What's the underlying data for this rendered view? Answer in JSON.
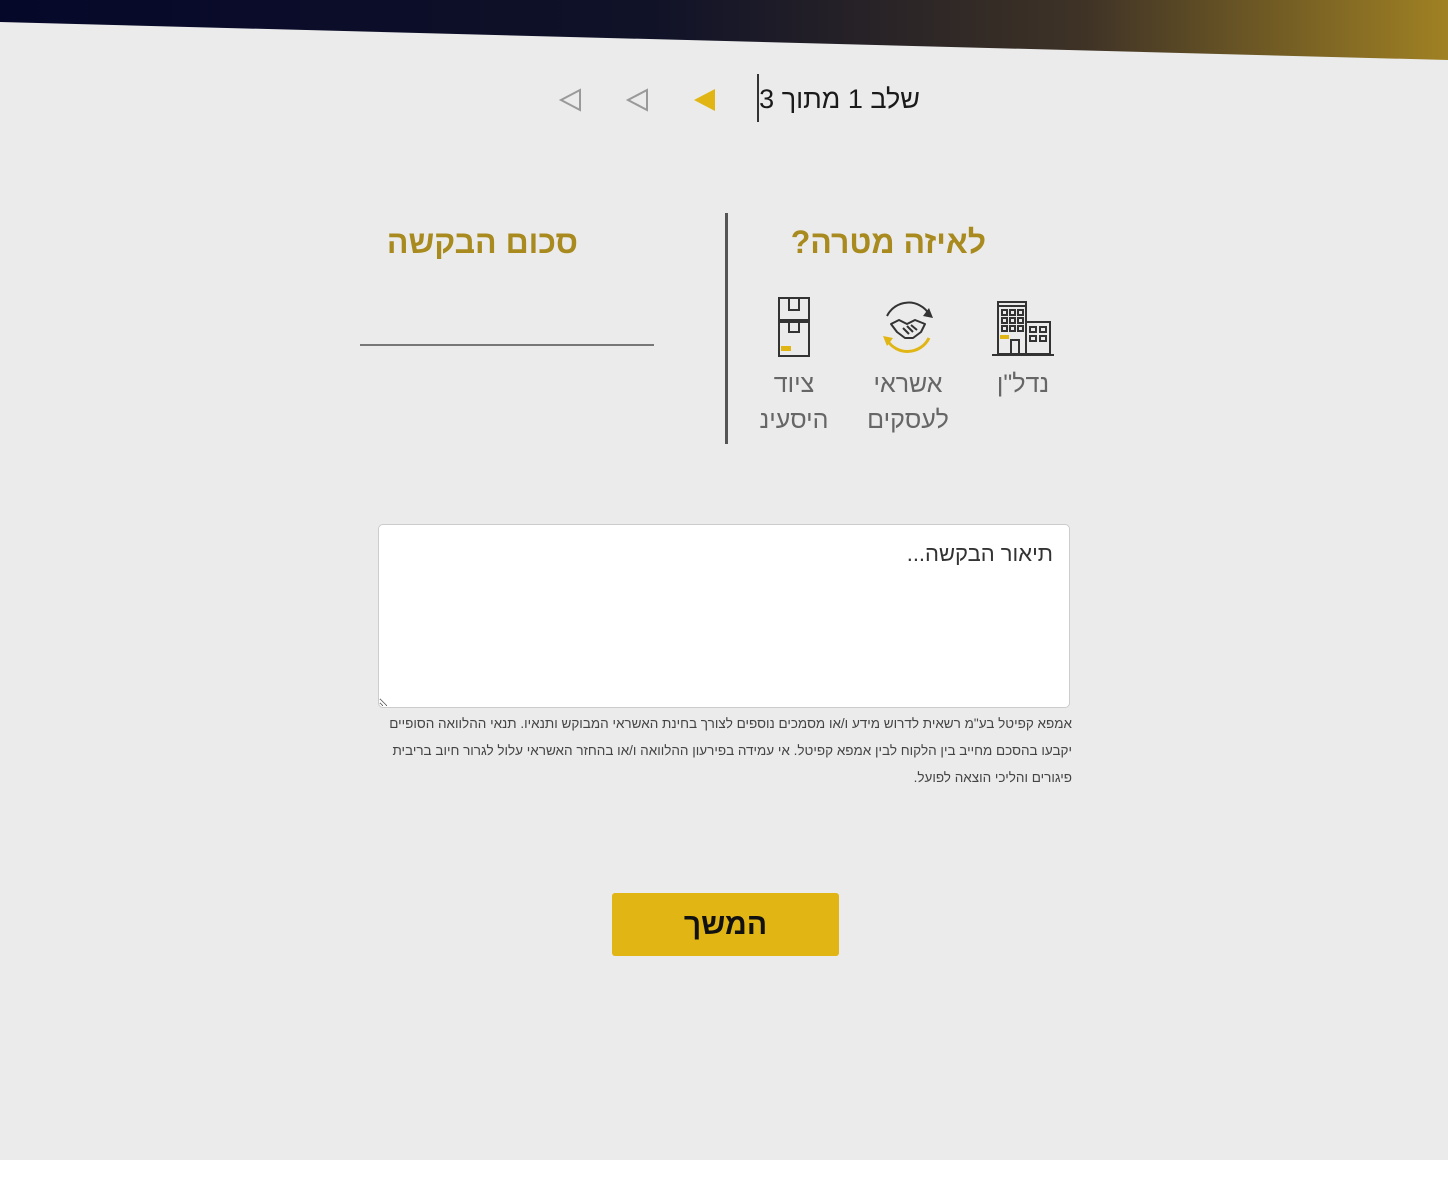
{
  "stepper": {
    "text": "שלב 1 מתוך 3",
    "current_step": 1,
    "total_steps": 3,
    "active_color": "#e0b514",
    "inactive_color": "#999999"
  },
  "purpose": {
    "title": "לאיזה מטרה?",
    "options": [
      {
        "label": "נדל\"ן",
        "icon": "buildings-icon"
      },
      {
        "label": "אשראי לעסקים",
        "icon": "handshake-icon"
      },
      {
        "label": "ציוד היסעינ",
        "icon": "package-icon"
      }
    ]
  },
  "amount": {
    "title": "סכום הבקשה",
    "value": ""
  },
  "description": {
    "placeholder": "תיאור הבקשה...",
    "value": ""
  },
  "disclaimer": "אמפא קפיטל בע\"מ רשאית לדרוש מידע ו/או מסמכים נוספים לצורך בחינת האשראי המבוקש ותנאיו. תנאי ההלוואה הסופיים יקבעו בהסכם מחייב בין הלקוח לבין אמפא קפיטל. אי עמידה בפירעון ההלוואה ו/או בהחזר האשראי עלול לגרור חיוב בריבית פיגורים והליכי הוצאה לפועל.",
  "continue_label": "המשך",
  "colors": {
    "accent": "#e0b514",
    "title_gold": "#a88a1e",
    "band_dark": "#0d0f2a",
    "band_gold": "#9a7a22",
    "background": "#ebebeb"
  }
}
